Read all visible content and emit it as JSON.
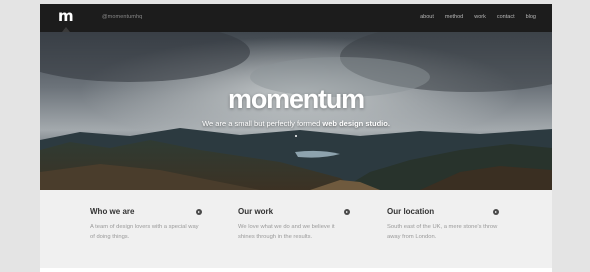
{
  "header": {
    "logo": "m",
    "handle": "@momentumhq",
    "nav": [
      "about",
      "method",
      "work",
      "contact",
      "blog"
    ]
  },
  "hero": {
    "title": "momentum",
    "tagline_prefix": "We are a small but perfectly formed ",
    "tagline_bold": "web design studio."
  },
  "features": [
    {
      "title": "Who we are",
      "text": "A team of design lovers with a special way of doing things.",
      "icon": "arrow-right-icon"
    },
    {
      "title": "Our work",
      "text": "We love what we do and we believe it shines through in the results.",
      "icon": "arrow-right-icon"
    },
    {
      "title": "Our location",
      "text": "South east of the UK, a mere stone's throw away from London.",
      "icon": "arrow-right-icon"
    }
  ],
  "colors": {
    "header_bg": "#1c1c1c",
    "features_bg": "#f0f0f0",
    "page_bg": "#e4e4e4"
  }
}
